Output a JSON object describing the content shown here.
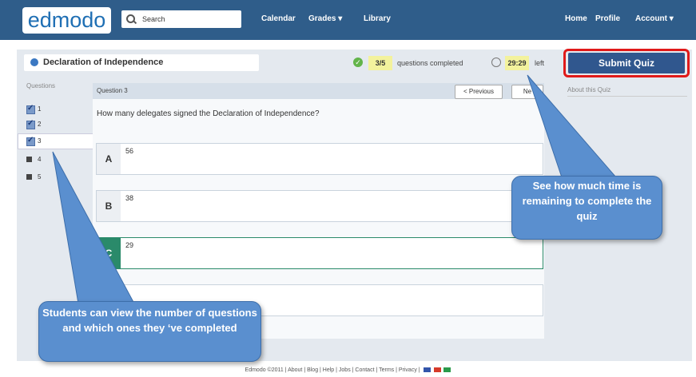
{
  "app": {
    "logo": "edmodo"
  },
  "header": {
    "search_placeholder": "Search",
    "nav": [
      "Calendar",
      "Grades ▾",
      "Library"
    ],
    "nav_right": [
      "Home",
      "Profile",
      "Account ▾"
    ]
  },
  "quiz": {
    "title": "Declaration of Independence",
    "progress_value": "3/5",
    "progress_text": "questions completed",
    "time_value": "29:29",
    "time_text": "left",
    "submit_label": "Submit Quiz",
    "about_label": "About this Quiz",
    "questions_header": "Questions",
    "questions": [
      "1",
      "2",
      "3",
      "4",
      "5"
    ],
    "completed": [
      true,
      true,
      true,
      false,
      false
    ],
    "current_label": "Question 3",
    "prev_label": "< Previous",
    "next_label": "Ne",
    "question_text": "How many delegates signed the Declaration of Independence?",
    "answers": [
      {
        "letter": "A",
        "text": "56"
      },
      {
        "letter": "B",
        "text": "38"
      },
      {
        "letter": "C",
        "text": "29"
      },
      {
        "letter": "",
        "text": ""
      }
    ]
  },
  "callouts": {
    "right": "See how much time is remaining to complete the quiz",
    "left": "Students can view the number of questions and which ones they ‘ve completed"
  },
  "footer": "Edmodo ©2011 | About | Blog | Help | Jobs | Contact | Terms | Privacy |",
  "colors": {
    "topbar": "#2f5d8a",
    "accent": "#30578e",
    "callout": "#5a8fcf",
    "selected": "#2a8a6a",
    "highlight": "#f3f29d"
  }
}
